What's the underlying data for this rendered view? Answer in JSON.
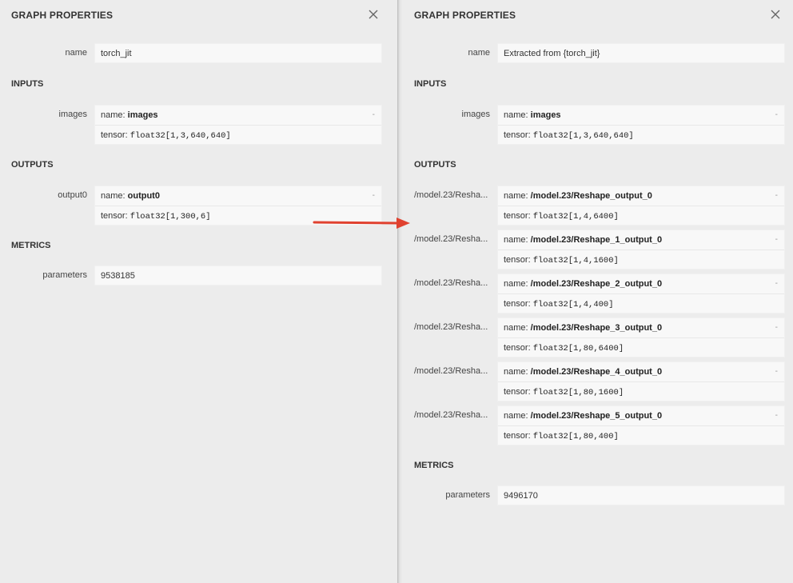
{
  "left": {
    "title": "GRAPH PROPERTIES",
    "name_label": "name",
    "name_value": "torch_jit",
    "inputs_title": "INPUTS",
    "input": {
      "label": "images",
      "name_prefix": "name:",
      "name": "images",
      "tensor_prefix": "tensor:",
      "tensor": "float32[1,3,640,640]",
      "toggle": "-"
    },
    "outputs_title": "OUTPUTS",
    "output": {
      "label": "output0",
      "name_prefix": "name:",
      "name": "output0",
      "tensor_prefix": "tensor:",
      "tensor": "float32[1,300,6]",
      "toggle": "-"
    },
    "metrics_title": "METRICS",
    "parameters_label": "parameters",
    "parameters_value": "9538185"
  },
  "right": {
    "title": "GRAPH PROPERTIES",
    "name_label": "name",
    "name_value": "Extracted from {torch_jit}",
    "inputs_title": "INPUTS",
    "input": {
      "label": "images",
      "name_prefix": "name:",
      "name": "images",
      "tensor_prefix": "tensor:",
      "tensor": "float32[1,3,640,640]",
      "toggle": "-"
    },
    "outputs_title": "OUTPUTS",
    "outputs": [
      {
        "label": "/model.23/Resha...",
        "name_prefix": "name:",
        "name": "/model.23/Reshape_output_0",
        "tensor_prefix": "tensor:",
        "tensor": "float32[1,4,6400]",
        "toggle": "-"
      },
      {
        "label": "/model.23/Resha...",
        "name_prefix": "name:",
        "name": "/model.23/Reshape_1_output_0",
        "tensor_prefix": "tensor:",
        "tensor": "float32[1,4,1600]",
        "toggle": "-"
      },
      {
        "label": "/model.23/Resha...",
        "name_prefix": "name:",
        "name": "/model.23/Reshape_2_output_0",
        "tensor_prefix": "tensor:",
        "tensor": "float32[1,4,400]",
        "toggle": "-"
      },
      {
        "label": "/model.23/Resha...",
        "name_prefix": "name:",
        "name": "/model.23/Reshape_3_output_0",
        "tensor_prefix": "tensor:",
        "tensor": "float32[1,80,6400]",
        "toggle": "-"
      },
      {
        "label": "/model.23/Resha...",
        "name_prefix": "name:",
        "name": "/model.23/Reshape_4_output_0",
        "tensor_prefix": "tensor:",
        "tensor": "float32[1,80,1600]",
        "toggle": "-"
      },
      {
        "label": "/model.23/Resha...",
        "name_prefix": "name:",
        "name": "/model.23/Reshape_5_output_0",
        "tensor_prefix": "tensor:",
        "tensor": "float32[1,80,400]",
        "toggle": "-"
      }
    ],
    "metrics_title": "METRICS",
    "parameters_label": "parameters",
    "parameters_value": "9496170"
  },
  "colors": {
    "background": "#ececec",
    "field": "#f8f8f8",
    "arrow": "#e0412f"
  },
  "icons": {
    "close": "close-icon",
    "arrow": "arrow-right-icon"
  }
}
